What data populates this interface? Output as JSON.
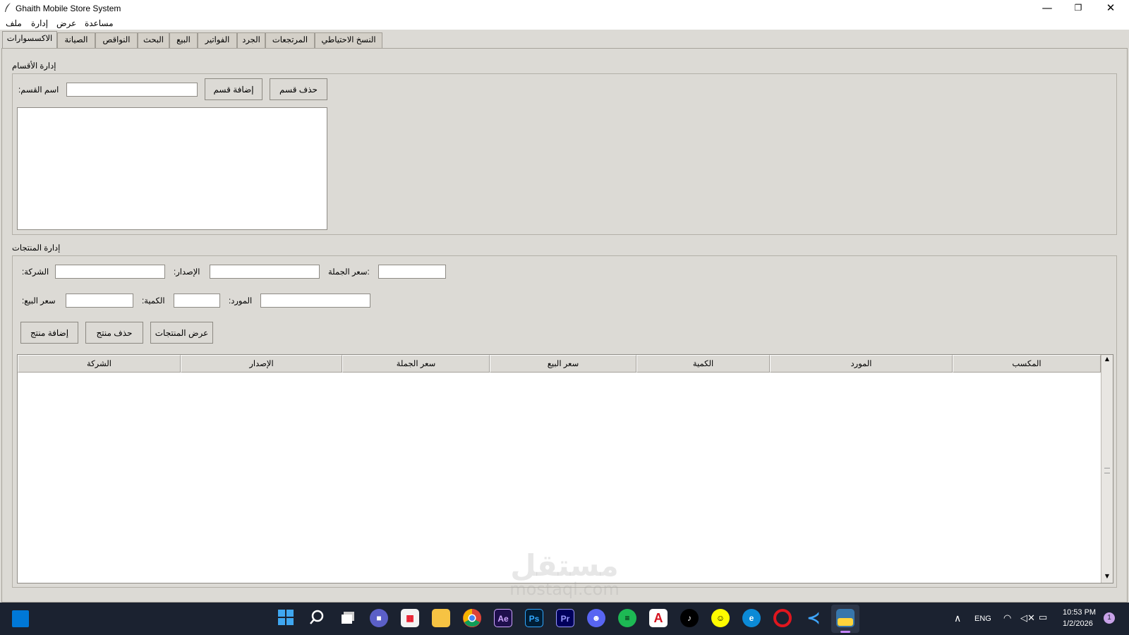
{
  "window": {
    "title": "Ghaith Mobile Store System",
    "controls": {
      "minimize": "—",
      "maximize": "❐",
      "close": "✕"
    }
  },
  "menu": [
    "ملف",
    "إدارة",
    "عرض",
    "مساعدة"
  ],
  "tabs": [
    "الاكسسوارات",
    "الصيانة",
    "النواقص",
    "البحث",
    "البيع",
    "الفواتير",
    "الجرد",
    "المرتجعات",
    "النسخ الاحتياطي"
  ],
  "active_tab": "الاكسسوارات",
  "categories_section": {
    "title": "إدارة الأقسام",
    "name_label": ":اسم القسم",
    "name_value": "",
    "add_button": "إضافة قسم",
    "delete_button": "حذف قسم",
    "list_items": []
  },
  "products_section": {
    "title": "إدارة المنتجات",
    "fields": {
      "company_label": ":الشركة",
      "version_label": ":الإصدار",
      "wholesale_label": "سعر الجملة:",
      "sale_price_label": ":سعر البيع",
      "quantity_label": ":الكمية",
      "supplier_label": ":المورد"
    },
    "buttons": {
      "add": "إضافة منتج",
      "delete": "حذف منتج",
      "show": "عرض المنتجات"
    },
    "table": {
      "columns": [
        "الشركة",
        "الإصدار",
        "سعر الجملة",
        "سعر البيع",
        "الكمية",
        "المورد",
        "المكسب"
      ],
      "rows": []
    }
  },
  "watermark": {
    "arabic": "مستقل",
    "latin": "mostaql.com"
  },
  "taskbar": {
    "icons": [
      "start-icon",
      "search-icon",
      "task-view-icon",
      "teams-icon",
      "store-icon",
      "file-explorer-icon",
      "chrome-icon",
      "after-effects-icon",
      "photoshop-icon",
      "premiere-icon",
      "discord-icon",
      "spotify-icon",
      "acrobat-icon",
      "tiktok-icon",
      "snapchat-icon",
      "edge-icon",
      "opera-icon",
      "vscode-icon",
      "python-icon"
    ],
    "app_labels": {
      "ae": "Ae",
      "ps": "Ps",
      "pr": "Pr",
      "acrobat": "A"
    },
    "language": "ENG",
    "time": "10:53 PM",
    "date": "1/2/2026",
    "notification_count": "1"
  },
  "colors": {
    "window_bg": "#dcdad5",
    "taskbar_bg": "#1b2230",
    "entry_bg": "#ffffff"
  }
}
